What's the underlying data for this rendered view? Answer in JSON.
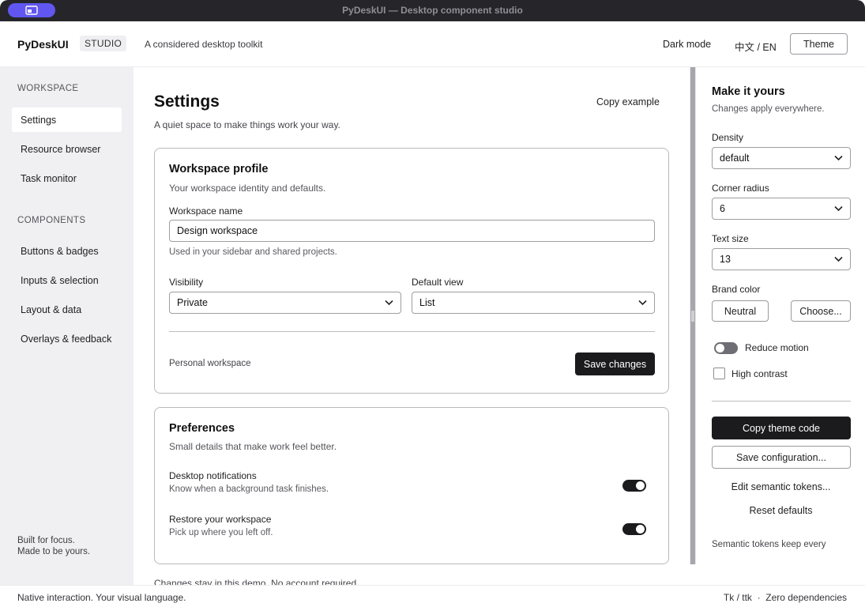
{
  "window": {
    "title": "PyDeskUI — Desktop component studio"
  },
  "header": {
    "brand": "PyDeskUI",
    "badge": "STUDIO",
    "tagline": "A considered desktop toolkit",
    "dark_mode": "Dark mode",
    "language": "中文 / EN",
    "theme_button": "Theme"
  },
  "sidebar": {
    "workspace_heading": "WORKSPACE",
    "workspace_items": [
      {
        "label": "Settings",
        "active": true
      },
      {
        "label": "Resource browser"
      },
      {
        "label": "Task monitor"
      }
    ],
    "components_heading": "COMPONENTS",
    "component_items": [
      {
        "label": "Buttons & badges"
      },
      {
        "label": "Inputs & selection"
      },
      {
        "label": "Layout & data"
      },
      {
        "label": "Overlays & feedback"
      }
    ],
    "footer_line1": "Built for focus.",
    "footer_line2": "Made to be yours."
  },
  "main": {
    "title": "Settings",
    "subtitle": "A quiet space to make things work your way.",
    "copy_example": "Copy example",
    "profile_card": {
      "title": "Workspace profile",
      "subtitle": "Your workspace identity and defaults.",
      "name_label": "Workspace name",
      "name_value": "Design workspace",
      "name_hint": "Used in your sidebar and shared projects.",
      "visibility_label": "Visibility",
      "visibility_value": "Private",
      "default_view_label": "Default view",
      "default_view_value": "List",
      "footer_text": "Personal workspace",
      "save_button": "Save changes"
    },
    "preferences_card": {
      "title": "Preferences",
      "subtitle": "Small details that make work feel better.",
      "items": [
        {
          "title": "Desktop notifications",
          "description": "Know when a background task finishes.",
          "enabled": true
        },
        {
          "title": "Restore your workspace",
          "description": "Pick up where you left off.",
          "enabled": true
        }
      ]
    },
    "footer_note": "Changes stay in this demo. No account required."
  },
  "right_panel": {
    "title": "Make it yours",
    "subtitle": "Changes apply everywhere.",
    "density_label": "Density",
    "density_value": "default",
    "radius_label": "Corner radius",
    "radius_value": "6",
    "text_size_label": "Text size",
    "text_size_value": "13",
    "brand_color_label": "Brand color",
    "brand_neutral": "Neutral",
    "brand_choose": "Choose...",
    "reduce_motion_label": "Reduce motion",
    "reduce_motion_enabled": false,
    "high_contrast_label": "High contrast",
    "high_contrast_checked": false,
    "copy_theme_button": "Copy theme code",
    "save_config_button": "Save configuration...",
    "edit_tokens_link": "Edit semantic tokens...",
    "reset_link": "Reset defaults",
    "footer_text": "Semantic tokens keep every"
  },
  "statusbar": {
    "left": "Native interaction. Your visual language.",
    "right": "Tk / ttk  ·  Zero dependencies"
  },
  "colors": {
    "accent_pill": "#6157f0",
    "dark": "#1b1b1e",
    "sidebar_bg": "#f0f0f3",
    "titlebar_bg": "#26262a"
  }
}
